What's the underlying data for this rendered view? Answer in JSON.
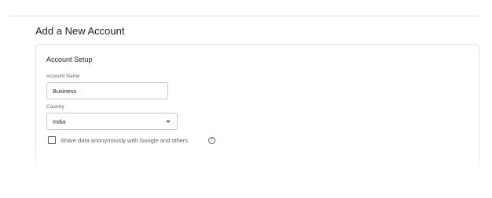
{
  "page": {
    "title": "Add a New Account"
  },
  "account_setup": {
    "section_title": "Account Setup",
    "account_name": {
      "label": "Account Name",
      "value": "Business"
    },
    "country": {
      "label": "Country",
      "selected": "India"
    },
    "share_data": {
      "label": "Share data anonymously with Google and others",
      "checked": false
    }
  },
  "icons": {
    "help": "?"
  }
}
